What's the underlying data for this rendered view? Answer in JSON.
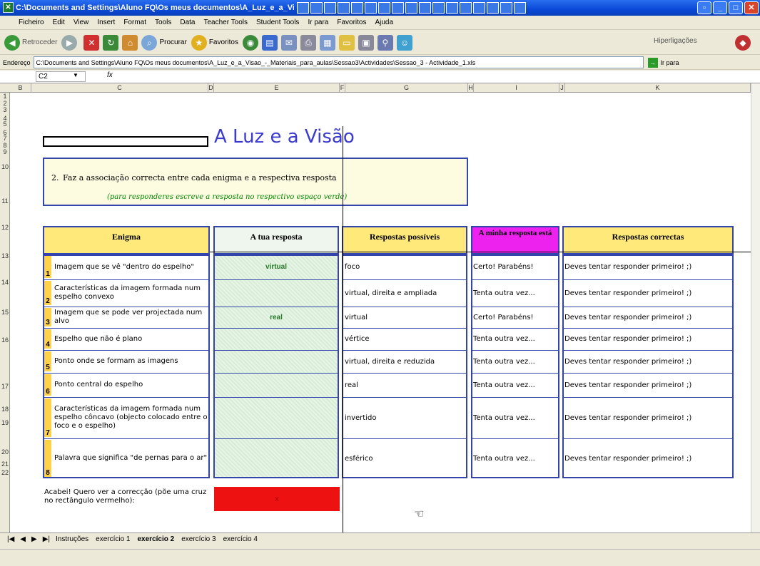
{
  "window": {
    "title": "C:\\Documents and Settings\\Aluno FQ\\Os meus documentos\\A_Luz_e_a_Visao_-"
  },
  "menu": [
    "Ficheiro",
    "Edit",
    "View",
    "Insert",
    "Format",
    "Tools",
    "Data",
    "Teacher Tools",
    "Student Tools",
    "Ir para",
    "Favoritos",
    "Ajuda"
  ],
  "toolbar": {
    "back": "Retroceder",
    "search": "Procurar",
    "favorites": "Favoritos",
    "links": "Hiperligações"
  },
  "address": {
    "label": "Endereço",
    "value": "C:\\Documents and Settings\\Aluno FQ\\Os meus documentos\\A_Luz_e_a_Visao_-_Materiais_para_aulas\\Sessao3\\Actividades\\Sessao_3 - Actividade_1.xls",
    "go": "Ir para"
  },
  "formula": {
    "namebox": "C2",
    "fx": "fx"
  },
  "columns": [
    "B",
    "C",
    "D",
    "E",
    "F",
    "G",
    "H",
    "I",
    "J",
    "K"
  ],
  "rows": [
    "1",
    "2",
    "3",
    "4",
    "5",
    "6",
    "7",
    "8",
    "9",
    "10",
    "11",
    "12",
    "13",
    "14",
    "15",
    "16",
    "17",
    "18",
    "19",
    "20",
    "21",
    "22"
  ],
  "sheet": {
    "title": "A Luz e a Visão",
    "question_num": "2.",
    "question": "Faz a associação correcta entre cada enigma e a respectiva resposta",
    "hint": "(para responderes escreve a resposta no respectivo espaço verde)",
    "headers": {
      "enigma": "Enigma",
      "answer": "A tua resposta",
      "possible": "Respostas possíveis",
      "status": "A minha resposta está",
      "correct": "Respostas correctas"
    },
    "items": [
      {
        "n": "1",
        "enigma": "Imagem que se vê \"dentro do espelho\"",
        "answer": "virtual",
        "possible": "foco",
        "status": "Certo! Parabéns!",
        "correct": "Deves tentar responder primeiro! ;)"
      },
      {
        "n": "2",
        "enigma": "Características da imagem formada num espelho convexo",
        "answer": "",
        "possible": "virtual, direita e ampliada",
        "status": "Tenta outra vez...",
        "correct": "Deves tentar responder primeiro! ;)"
      },
      {
        "n": "3",
        "enigma": "Imagem que se pode ver projectada num alvo",
        "answer": "real",
        "possible": "virtual",
        "status": "Certo! Parabéns!",
        "correct": "Deves tentar responder primeiro! ;)"
      },
      {
        "n": "4",
        "enigma": "Espelho que não é plano",
        "answer": "",
        "possible": "vértice",
        "status": "Tenta outra vez...",
        "correct": "Deves tentar responder primeiro! ;)"
      },
      {
        "n": "5",
        "enigma": "Ponto onde se formam as imagens",
        "answer": "",
        "possible": "virtual, direita e reduzida",
        "status": "Tenta outra vez...",
        "correct": "Deves tentar responder primeiro! ;)"
      },
      {
        "n": "6",
        "enigma": "Ponto central do espelho",
        "answer": "",
        "possible": "real",
        "status": "Tenta outra vez...",
        "correct": "Deves tentar responder primeiro! ;)"
      },
      {
        "n": "7",
        "enigma": "Características da imagem formada num espelho côncavo (objecto colocado entre o foco e o espelho)",
        "answer": "",
        "possible": "invertido",
        "status": "Tenta outra vez...",
        "correct": "Deves tentar responder primeiro! ;)"
      },
      {
        "n": "8",
        "enigma": "Palavra que significa \"de pernas para o ar\"",
        "answer": "",
        "possible": "esférico",
        "status": "Tenta outra vez...",
        "correct": "Deves tentar responder primeiro! ;)"
      }
    ],
    "finish_label": "Acabei! Quero ver a correcção (põe uma cruz no rectângulo vermelho):",
    "finish_mark": "x"
  },
  "tabs": [
    "Instruções",
    "exercício 1",
    "exercício 2",
    "exercício 3",
    "exercício 4"
  ],
  "active_tab": "exercício 2"
}
